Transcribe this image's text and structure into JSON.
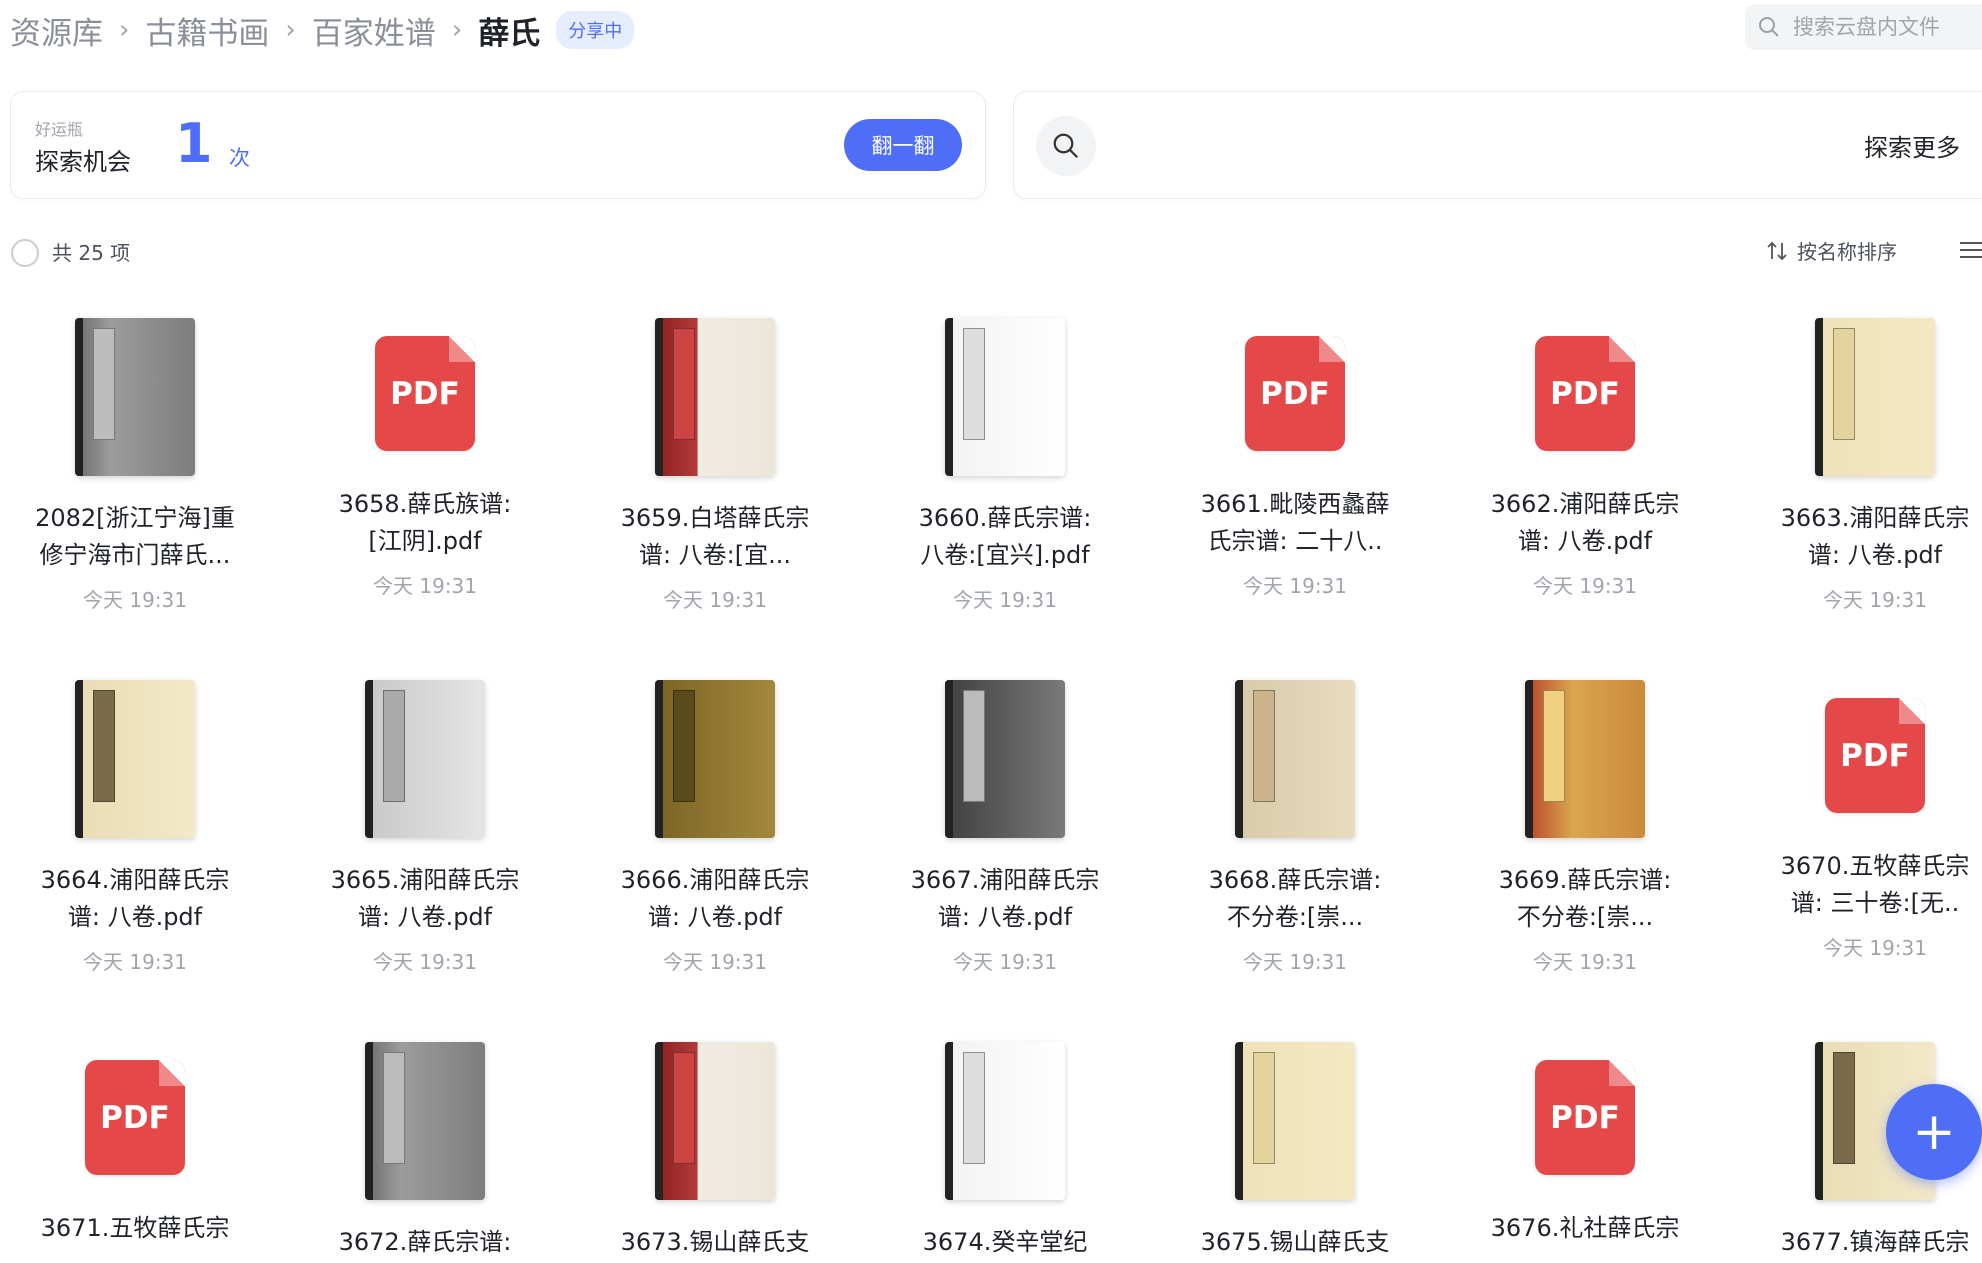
{
  "breadcrumb": {
    "items": [
      "资源库",
      "古籍书画",
      "百家姓谱"
    ],
    "current": "薛氏",
    "share_tag": "分享中"
  },
  "search": {
    "placeholder": "搜索云盘内文件"
  },
  "lucky": {
    "small_label": "好运瓶",
    "label": "探索机会",
    "count": "1",
    "unit": "次",
    "button": "翻一翻"
  },
  "explore": {
    "label": "探索更多"
  },
  "toolbar": {
    "count": "共 25 项",
    "sort": "按名称排序"
  },
  "files": [
    {
      "line1": "2082[浙江宁海]重",
      "line2": "修宁海市门薛氏...",
      "time": "今天 19:31",
      "thumb": "book"
    },
    {
      "line1": "3658.薛氏族谱:",
      "line2": "[江阴].pdf",
      "time": "今天 19:31",
      "thumb": "pdf"
    },
    {
      "line1": "3659.白塔薛氏宗",
      "line2": "谱: 八卷:[宜...",
      "time": "今天 19:31",
      "thumb": "book"
    },
    {
      "line1": "3660.薛氏宗谱:",
      "line2": "八卷:[宜兴].pdf",
      "time": "今天 19:31",
      "thumb": "book"
    },
    {
      "line1": "3661.毗陵西蠡薛",
      "line2": "氏宗谱: 二十八..",
      "time": "今天 19:31",
      "thumb": "pdf"
    },
    {
      "line1": "3662.浦阳薛氏宗",
      "line2": "谱: 八卷.pdf",
      "time": "今天 19:31",
      "thumb": "pdf"
    },
    {
      "line1": "3663.浦阳薛氏宗",
      "line2": "谱: 八卷.pdf",
      "time": "今天 19:31",
      "thumb": "book"
    },
    {
      "line1": "3664.浦阳薛氏宗",
      "line2": "谱: 八卷.pdf",
      "time": "今天 19:31",
      "thumb": "book"
    },
    {
      "line1": "3665.浦阳薛氏宗",
      "line2": "谱: 八卷.pdf",
      "time": "今天 19:31",
      "thumb": "book"
    },
    {
      "line1": "3666.浦阳薛氏宗",
      "line2": "谱: 八卷.pdf",
      "time": "今天 19:31",
      "thumb": "book"
    },
    {
      "line1": "3667.浦阳薛氏宗",
      "line2": "谱: 八卷.pdf",
      "time": "今天 19:31",
      "thumb": "book"
    },
    {
      "line1": "3668.薛氏宗谱:",
      "line2": "不分卷:[崇...",
      "time": "今天 19:31",
      "thumb": "book"
    },
    {
      "line1": "3669.薛氏宗谱:",
      "line2": "不分卷:[崇...",
      "time": "今天 19:31",
      "thumb": "book"
    },
    {
      "line1": "3670.五牧薛氏宗",
      "line2": "谱: 三十卷:[无..",
      "time": "今天 19:31",
      "thumb": "pdf"
    },
    {
      "line1": "3671.五牧薛氏宗",
      "line2": "",
      "time": "",
      "thumb": "pdf"
    },
    {
      "line1": "3672.薛氏宗谱:",
      "line2": "",
      "time": "",
      "thumb": "book"
    },
    {
      "line1": "3673.锡山薛氏支",
      "line2": "",
      "time": "",
      "thumb": "book"
    },
    {
      "line1": "3674.癸辛堂纪",
      "line2": "",
      "time": "",
      "thumb": "book"
    },
    {
      "line1": "3675.锡山薛氏支",
      "line2": "",
      "time": "",
      "thumb": "book"
    },
    {
      "line1": "3676.礼社薛氏宗",
      "line2": "",
      "time": "",
      "thumb": "pdf"
    },
    {
      "line1": "3677.镇海薛氏宗",
      "line2": "",
      "time": "",
      "thumb": "book"
    }
  ],
  "pdf_label": "PDF",
  "fab": {
    "label": "+"
  },
  "colors": {
    "accent": "#4f6ef7",
    "pdf_red": "#e44848"
  }
}
